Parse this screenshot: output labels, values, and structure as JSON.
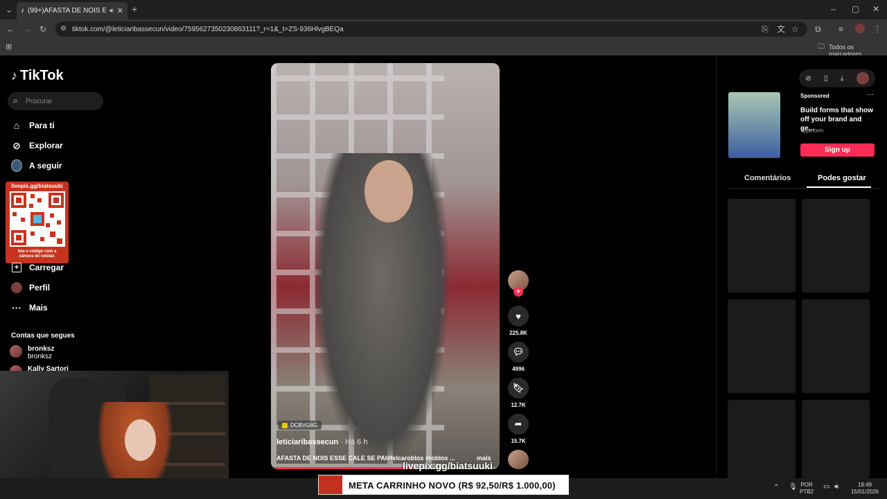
{
  "browser": {
    "tab_title": "(99+)AFASTA DE NOIS ESSE",
    "url": "tiktok.com/@leticiaribassecun/video/7595627350230863111?_r=1&_t=ZS-936HlvgBEQa",
    "bookmarks_label": "Todos os marcadores"
  },
  "sidebar": {
    "logo": "TikTok",
    "search_placeholder": "Procurar",
    "nav": [
      {
        "label": "Para ti",
        "icon": "home-icon"
      },
      {
        "label": "Explorar",
        "icon": "compass-icon"
      },
      {
        "label": "A seguir",
        "icon": "following-avatar-icon"
      },
      {
        "label": "Carregar",
        "icon": "upload-icon"
      },
      {
        "label": "Perfil",
        "icon": "profile-avatar-icon"
      },
      {
        "label": "Mais",
        "icon": "more-icon"
      }
    ],
    "qr": {
      "url": "livepix.gg/biatsuuki",
      "caption_line1": "leia o código com a",
      "caption_line2": "câmera do celular."
    },
    "following_title": "Contas que segues",
    "accounts": [
      {
        "name": "bronksz",
        "handle": "bronksz"
      },
      {
        "name": "Kally Sartori",
        "handle": ""
      }
    ]
  },
  "video": {
    "creator_code": "DCBVG6G",
    "author": "leticiaribassecun",
    "time": "· Há 6 h",
    "caption": "AFASTA DE NOIS ESSE CALE SE PAI#felcaroblox #roblox ...",
    "more_label": "mais",
    "progress": 0.62
  },
  "actions": {
    "likes": "225.8K",
    "comments": "4996",
    "saves": "12.7K",
    "shares": "15.7K"
  },
  "ad": {
    "sponsored": "Sponsored",
    "title": "Build forms that show off your brand and ge...",
    "brand": "Typeform",
    "cta": "Sign up"
  },
  "right_tabs": {
    "comments": "Comentários",
    "suggested": "Podes gostar"
  },
  "stream_overlay": {
    "url": "livepix.gg/biatsuuki",
    "goal": "META CARRINHO NOVO (R$ 92,50/R$ 1.000,00)"
  },
  "taskbar": {
    "lang1": "POR",
    "lang2": "PTB2",
    "time": "19:49",
    "date": "15/01/2026"
  }
}
